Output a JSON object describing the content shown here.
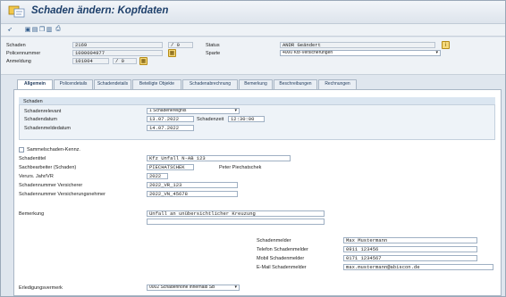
{
  "window": {
    "title": "Schaden ändern: Kopfdaten"
  },
  "toolbar": {
    "icons": [
      "exit-icon",
      "save-icon",
      "print-icon",
      "copy-icon",
      "display-icon",
      "print-preview-icon"
    ]
  },
  "header": {
    "schaden_label": "Schaden",
    "schaden_value": "2169",
    "schaden_suffix": "/ 0",
    "police_label": "Policennummer",
    "police_value": "1000004977",
    "anmeldung_label": "Anmeldung",
    "anmeldung_value": "101004",
    "anmeldung_suffix": "/ 0",
    "status_label": "Status",
    "status_value": "ÄNDR Geändert",
    "sparte_label": "Sparte",
    "sparte_value": "4000 Kfz-Versicherungen"
  },
  "tabs": [
    "Allgemein",
    "Policendetails",
    "Schadendetails",
    "Beteiligte Objekte",
    "Schadenabrechnung",
    "Bemerkung",
    "Beschreibungen",
    "Rechnungen"
  ],
  "schaden_group": {
    "title": "Schaden",
    "relevant_label": "Schadenrelevant",
    "relevant_value": "1 Schadenereignis",
    "datum_label": "Schadendatum",
    "datum_value": "13.07.2022",
    "zeit_label": "Schadenzeit",
    "zeit_value": "12:30:00",
    "meldedatum_label": "Schadenmeldedatum",
    "meldedatum_value": "14.07.2022"
  },
  "details": {
    "sammel_label": "Sammelschaden-Kennz.",
    "titel_label": "Schadentitel",
    "titel_value": "Kfz Unfall N-AB 123",
    "sachbearbeiter_label": "Sachbearbeiter (Schaden)",
    "sachbearbeiter_value": "PIECHATSCHEK",
    "sachbearbeiter_name": "Peter Piechatschek",
    "jahr_label": "Verurs. Jahr/VR",
    "jahr_value": "2022",
    "nr_vers_label": "Schadennummer Versicherer",
    "nr_vers_value": "2022_VR_123",
    "nr_vn_label": "Schadennummer Versicherungsnehmer",
    "nr_vn_value": "2022_VN_45678",
    "bemerkung_label": "Bemerkung",
    "bemerkung_value": "Unfall an unübersichtlicher Kreuzung"
  },
  "melder": {
    "melder_label": "Schadenmelder",
    "melder_value": "Max Mustermann",
    "telefon_label": "Telefon Schadenmelder",
    "telefon_value": "0911 123456",
    "mobil_label": "Mobil Schadenmelder",
    "mobil_value": "0171 1234567",
    "email_label": "E-Mail Schadenmelder",
    "email_value": "max.mustermann@abiscon.de"
  },
  "footer": {
    "erledigung_label": "Erledigungsvermerk",
    "erledigung_value": "0002 Schadenhöhe innerhalb SB"
  }
}
